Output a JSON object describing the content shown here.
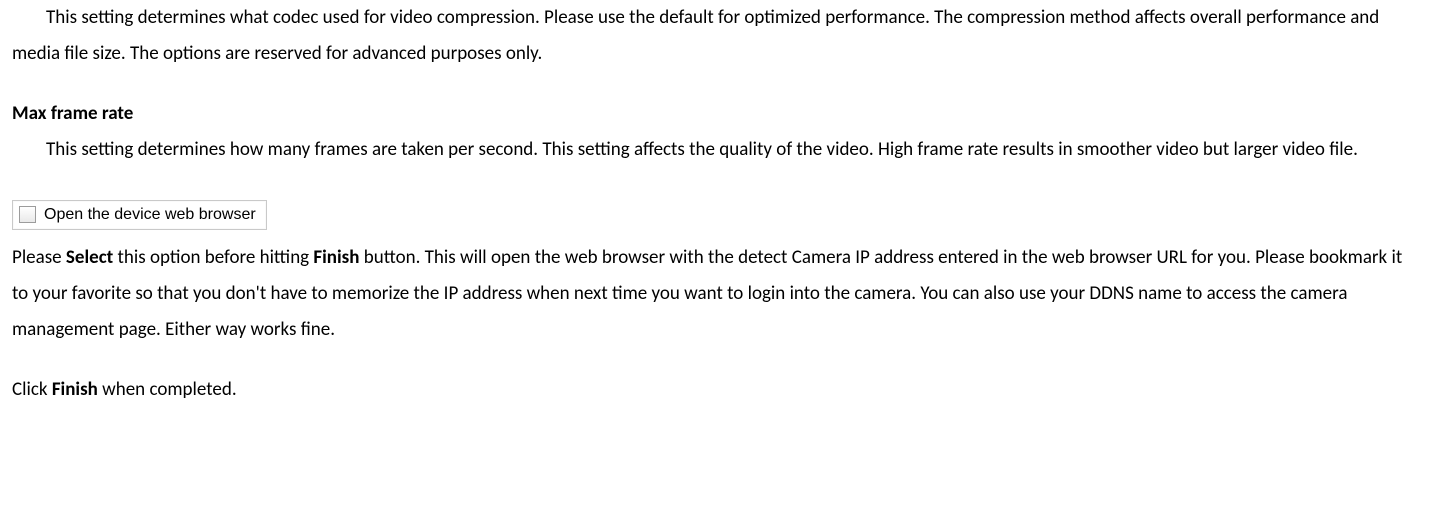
{
  "codec": {
    "description": "This setting determines what codec used for video compression. Please use the default for optimized performance. The compression method affects overall performance and media file size. The options are reserved for advanced purposes only."
  },
  "framerate": {
    "heading": "Max frame rate",
    "description": "This setting determines how many frames are taken per second. This setting affects the quality of the video. High frame rate results in smoother video but larger video file."
  },
  "checkbox": {
    "label": "Open the device web browser"
  },
  "open_browser": {
    "pre": "Please ",
    "select": "Select",
    "mid1": " this option before hitting ",
    "finish": "Finish",
    "post": " button. This will open the web browser with the detect Camera IP address entered in the web browser URL for you. Please bookmark it to your favorite so that you don't have to memorize the IP address when next time you want to login into the camera. You can also use your DDNS name to access the camera management page. Either way works fine."
  },
  "closing": {
    "pre": "Click ",
    "finish": "Finish",
    "post": " when completed."
  }
}
